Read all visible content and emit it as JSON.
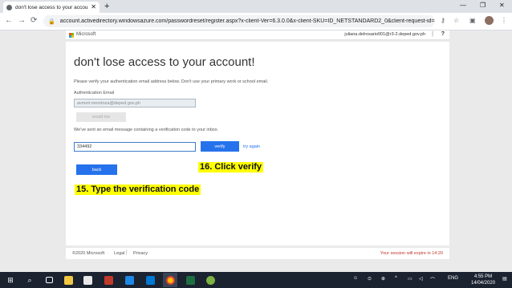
{
  "browser": {
    "tab_title": "don't lose access to your account",
    "tab_close": "✕",
    "new_tab": "+",
    "window_controls": [
      "—",
      "❐",
      "✕"
    ],
    "nav": {
      "back": "←",
      "forward": "→",
      "reload": "⟳"
    },
    "lock_glyph": "🔒",
    "url": "account.activedirectory.windowsazure.com/passwordreset/register.aspx?x-client-Ver=6.3.0.0&x-client-SKU=ID_NETSTANDARD2_0&client-request-id=2...",
    "icons": [
      "key-icon",
      "star-icon",
      "extension-icon",
      "profile-avatar",
      "menu-icon"
    ],
    "toolbar_glyphs": {
      "key": "⚷",
      "star": "☆",
      "extension": "▣",
      "menu": "⋮"
    }
  },
  "header": {
    "brand": "Microsoft",
    "user": "juliana.delrosario001@r3-2.deped.gov.ph",
    "separator": "|",
    "help": "?"
  },
  "main": {
    "title": "don't lose access to your account!",
    "intro": "Please verify your authentication email address below. Don't use your primary work or school email.",
    "email_label": "Authentication Email",
    "email_value": "avmeir.mendoza@deped.gov.ph",
    "email_button": "email me",
    "sent_message": "We've sent an email message containing a verification code to your inbox.",
    "code_value": "334492",
    "verify_button": "verify",
    "try_again": "try again",
    "back_button": "back"
  },
  "annotations": {
    "step16": "16. Click verify",
    "step15": "15. Type the verification code"
  },
  "footer": {
    "copyright": "©2020 Microsoft",
    "legal": "Legal",
    "separator": "|",
    "privacy": "Privacy",
    "expiry": "Your session will expire in 14:20"
  },
  "taskbar": {
    "apps": [
      "windows-start-icon",
      "search-icon",
      "task-view-icon",
      "file-explorer-icon",
      "media-app-icon",
      "lesson-app-icon",
      "mail-icon",
      "files-icon",
      "chrome-icon",
      "excel-icon",
      "paint-icon"
    ],
    "start_glyph": "⊞",
    "search_glyph": "⌕",
    "language": "ENG",
    "time": "4:55 PM",
    "date": "14/04/2020"
  },
  "colors": {
    "accent": "#2672ec",
    "annotation": "#ffff00",
    "expiry_text": "#c0392b",
    "taskbar": "#1b2230"
  }
}
